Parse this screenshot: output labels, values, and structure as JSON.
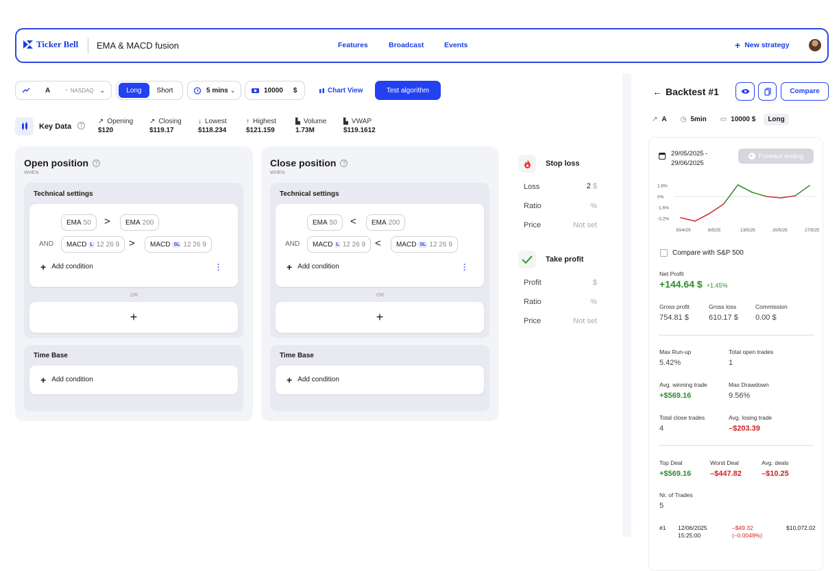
{
  "header": {
    "brand": "Ticker Bell",
    "page_title": "EMA & MACD fusion",
    "nav": [
      "Features",
      "Broadcast",
      "Events"
    ],
    "new_strategy": "New strategy"
  },
  "toolbar": {
    "symbol": "A",
    "exchange": "NASDAQ",
    "long": "Long",
    "short": "Short",
    "interval": "5 mins",
    "amount": "10000",
    "currency": "$",
    "chart_view": "Chart View",
    "test_algorithm": "Test algorithm"
  },
  "key_data": {
    "label": "Key Data",
    "items": [
      {
        "label": "Opening",
        "value": "$120"
      },
      {
        "label": "Closing",
        "value": "$119.17"
      },
      {
        "label": "Lowest",
        "value": "$118.234"
      },
      {
        "label": "Highest",
        "value": "$121.159"
      },
      {
        "label": "Volume",
        "value": "1.73M"
      },
      {
        "label": "VWAP",
        "value": "$119.1612"
      }
    ]
  },
  "open": {
    "title": "Open position",
    "when": "WHEN",
    "tech": "Technical settings",
    "r1a": "EMA",
    "r1a_n": "50",
    "r1op": ">",
    "r1b": "EMA",
    "r1b_n": "200",
    "and": "AND",
    "r2a": "MACD",
    "r2a_b": "L",
    "r2a_n": "12 26 9",
    "r2op": ">",
    "r2b": "MACD",
    "r2b_b": "SL",
    "r2b_n": "12 26 9",
    "add": "Add condition",
    "or": "OR",
    "plus": "+",
    "time": "Time Base",
    "add2": "Add condition"
  },
  "close": {
    "title": "Close position",
    "when": "WHEN",
    "tech": "Technical settings",
    "r1a": "EMA",
    "r1a_n": "50",
    "r1op": "<",
    "r1b": "EMA",
    "r1b_n": "200",
    "and": "AND",
    "r2a": "MACD",
    "r2a_b": "L",
    "r2a_n": "12 26 9",
    "r2op": "<",
    "r2b": "MACD",
    "r2b_b": "SL",
    "r2b_n": "12 26 9",
    "add": "Add condition",
    "or": "OR",
    "plus": "+",
    "time": "Time Base",
    "add2": "Add condition"
  },
  "stop_loss": {
    "title": "Stop loss",
    "loss_l": "Loss",
    "loss_v": "2",
    "loss_u": "$",
    "ratio_l": "Ratio",
    "ratio_u": "%",
    "price_l": "Price",
    "price_v": "Not set"
  },
  "take_profit": {
    "title": "Take profit",
    "profit_l": "Profit",
    "profit_u": "$",
    "ratio_l": "Ratio",
    "ratio_u": "%",
    "price_l": "Price",
    "price_v": "Not set"
  },
  "backtest": {
    "title": "Backtest #1",
    "compare": "Compare",
    "symbol": "A",
    "interval": "5min",
    "amount": "10000 $",
    "side": "Long",
    "date_range_1": "29/05/2025 -",
    "date_range_2": "29/06/2025",
    "forward": "Forward testing",
    "compare_sp": "Compare with S&P 500",
    "net_profit_l": "Net Profit",
    "net_profit_v": "+144.64 $",
    "net_profit_pct": "+1.45%",
    "gross_profit_l": "Gross profit",
    "gross_profit_v": "754.81 $",
    "gross_loss_l": "Gross loss",
    "gross_loss_v": "610.17 $",
    "commission_l": "Commission",
    "commission_v": "0.00 $",
    "max_runup_l": "Max Run-up",
    "max_runup_v": "5.42%",
    "open_trades_l": "Total open trades",
    "open_trades_v": "1",
    "avg_win_l": "Avg. winning trade",
    "avg_win_v": "+$569.16",
    "max_dd_l": "Max Drawdown",
    "max_dd_v": "9.56%",
    "close_trades_l": "Total close trades",
    "close_trades_v": "4",
    "avg_loss_l": "Avg. losing trade",
    "avg_loss_v": "–$203.39",
    "top_deal_l": "Top Deal",
    "top_deal_v": "+$569.16",
    "worst_deal_l": "Worst Deal",
    "worst_deal_v": "–$447.82",
    "avg_deals_l": "Avg. deals",
    "avg_deals_v": "–$10.25",
    "nr_trades_l": "Nr. of Trades",
    "nr_trades_v": "5",
    "trade1": {
      "id": "#1",
      "date": "12/06/2025",
      "time": "15:25:00",
      "pnl": "–$49.32",
      "pnl_pct": "(–0.0049%)",
      "balance": "$10,072.02"
    }
  },
  "chart_data": {
    "type": "line",
    "y_ticks": [
      "1.6%",
      "0%",
      "-1.6%",
      "-3.2%"
    ],
    "x_ticks": [
      "30/4/25",
      "6/5/25",
      "13/5/25",
      "20/5/25",
      "27/5/25"
    ],
    "ylim": [
      -4.0,
      2.4
    ],
    "x": [
      0,
      1,
      2,
      3,
      4,
      5,
      6,
      7,
      8,
      9
    ],
    "y": [
      -3.1,
      -3.6,
      -2.5,
      -1.1,
      1.7,
      0.6,
      0.0,
      -0.2,
      0.1,
      1.6
    ],
    "colors": {
      "negative": "#d42a2a",
      "positive": "#3a8f2e"
    }
  }
}
